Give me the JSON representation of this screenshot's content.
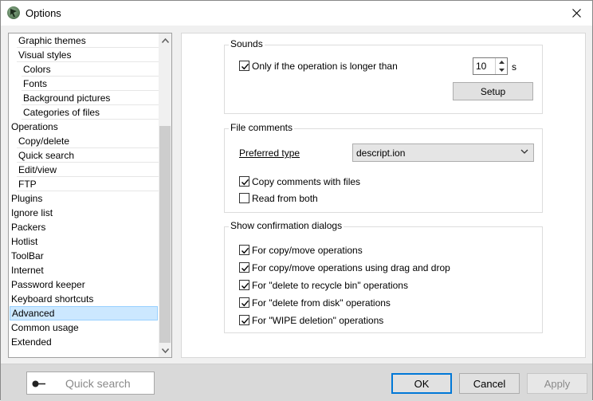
{
  "window": {
    "title": "Options"
  },
  "tree": {
    "items": [
      {
        "label": "Graphic themes",
        "indent": 1
      },
      {
        "label": "Visual styles",
        "indent": 1
      },
      {
        "label": "Colors",
        "indent": 2
      },
      {
        "label": "Fonts",
        "indent": 2
      },
      {
        "label": "Background pictures",
        "indent": 2
      },
      {
        "label": "Categories of files",
        "indent": 2
      },
      {
        "label": "Operations",
        "indent": 0
      },
      {
        "label": "Copy/delete",
        "indent": 1
      },
      {
        "label": "Quick search",
        "indent": 1
      },
      {
        "label": "Edit/view",
        "indent": 1
      },
      {
        "label": "FTP",
        "indent": 1
      },
      {
        "label": "Plugins",
        "indent": 0
      },
      {
        "label": "Ignore list",
        "indent": 0
      },
      {
        "label": "Packers",
        "indent": 0
      },
      {
        "label": "Hotlist",
        "indent": 0
      },
      {
        "label": "ToolBar",
        "indent": 0
      },
      {
        "label": "Internet",
        "indent": 0
      },
      {
        "label": "Password keeper",
        "indent": 0
      },
      {
        "label": "Keyboard shortcuts",
        "indent": 0
      },
      {
        "label": "Advanced",
        "indent": 0,
        "selected": true
      },
      {
        "label": "Common usage",
        "indent": 0
      },
      {
        "label": "Extended",
        "indent": 0
      }
    ]
  },
  "sounds": {
    "title": "Sounds",
    "only_if_longer_label": "Only if the operation is longer than",
    "only_if_longer_checked": true,
    "seconds_value": "10",
    "seconds_unit": "s",
    "setup_label": "Setup"
  },
  "file_comments": {
    "title": "File comments",
    "preferred_type_label": "Preferred type",
    "preferred_type_value": "descript.ion",
    "copy_comments_label": "Copy comments with files",
    "copy_comments_checked": true,
    "read_from_both_label": "Read from both",
    "read_from_both_checked": false
  },
  "confirmations": {
    "title": "Show confirmation dialogs",
    "items": [
      {
        "label": "For copy/move operations",
        "checked": true
      },
      {
        "label": "For copy/move operations using drag and drop",
        "checked": true
      },
      {
        "label": "For \"delete to recycle bin\" operations",
        "checked": true
      },
      {
        "label": "For \"delete from disk\" operations",
        "checked": true
      },
      {
        "label": "For \"WIPE deletion\" operations",
        "checked": true
      }
    ]
  },
  "bottom": {
    "quick_search_placeholder": "Quick search",
    "ok_label": "OK",
    "cancel_label": "Cancel",
    "apply_label": "Apply"
  },
  "colors": {
    "accent": "#0078d7",
    "selection": "#cce8ff"
  }
}
